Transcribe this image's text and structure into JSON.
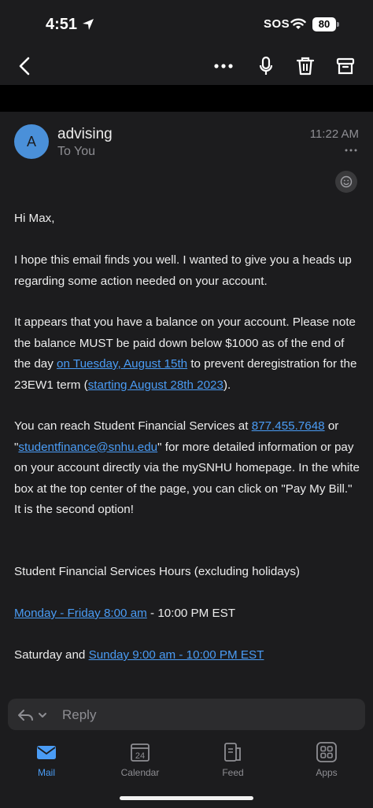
{
  "status_bar": {
    "time": "4:51",
    "sos": "SOS",
    "battery": "80"
  },
  "nav": {
    "back_icon": "chevron-left-icon",
    "more_icon": "ellipsis-icon",
    "mic_icon": "microphone-icon",
    "trash_icon": "trash-icon",
    "archive_icon": "archive-icon"
  },
  "email": {
    "avatar_letter": "A",
    "sender": "advising",
    "recipient": "To You",
    "time": "11:22 AM",
    "greeting": "Hi Max,",
    "para1": "I hope this email finds you well. I wanted to give you a heads up regarding some action needed on your account.",
    "para2_a": "It appears that you have a balance on your account. Please note the balance MUST be paid down below $1000 as of the end of the day ",
    "para2_link1": "on Tuesday, August 15th",
    "para2_b": " to prevent deregistration for the 23EW1 term (",
    "para2_link2": "starting August 28th 2023",
    "para2_c": ").",
    "para3_a": "You can reach Student Financial Services at ",
    "para3_phone": "877.455.7648",
    "para3_b": " or \"",
    "para3_email": "studentfinance@snhu.edu",
    "para3_c": "\" for more detailed information or pay on your account directly via the mySNHU homepage. In the white box at the top center of the page, you can click on \"Pay My Bill.\" It is the second option!",
    "hours_title": "Student Financial Services Hours (excluding holidays)",
    "hours1_link": "Monday - Friday 8:00 am",
    "hours1_text": " - 10:00 PM EST",
    "hours2_text": "Saturday and ",
    "hours2_link": "Sunday 9:00 am - 10:00 PM EST"
  },
  "reply": {
    "label": "Reply"
  },
  "tabs": [
    {
      "label": "Mail",
      "icon": "mail-icon"
    },
    {
      "label": "Calendar",
      "icon": "calendar-icon",
      "day": "24"
    },
    {
      "label": "Feed",
      "icon": "feed-icon"
    },
    {
      "label": "Apps",
      "icon": "apps-icon"
    }
  ],
  "colors": {
    "accent": "#4a9cf5",
    "avatar": "#4a90d9",
    "background": "#1c1c1e"
  }
}
